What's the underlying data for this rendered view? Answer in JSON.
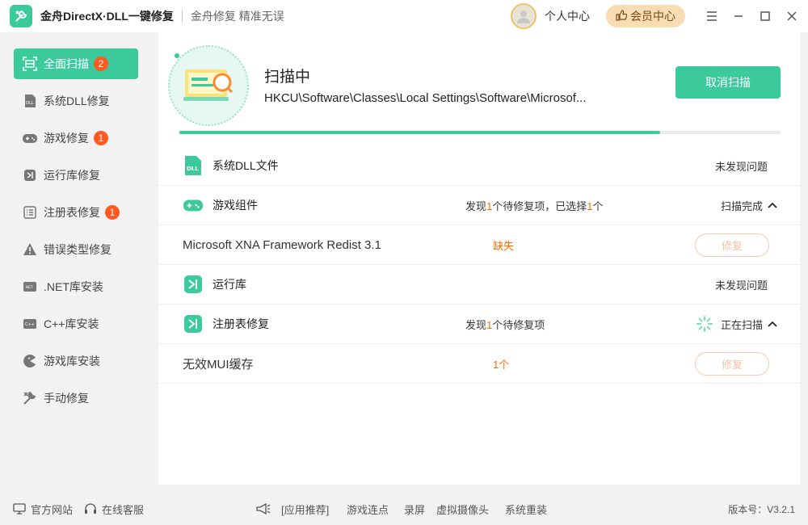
{
  "app": {
    "title": "金舟DirectX·DLL一键修复",
    "slogan": "金舟修复 精准无误",
    "profile_label": "个人中心",
    "vip_label": "会员中心"
  },
  "sidebar": {
    "items": [
      {
        "label": "全面扫描",
        "badge": "2"
      },
      {
        "label": "系统DLL修复",
        "badge": ""
      },
      {
        "label": "游戏修复",
        "badge": "1"
      },
      {
        "label": "运行库修复",
        "badge": ""
      },
      {
        "label": "注册表修复",
        "badge": "1"
      },
      {
        "label": "错误类型修复",
        "badge": ""
      },
      {
        "label": ".NET库安装",
        "badge": ""
      },
      {
        "label": "C++库安装",
        "badge": ""
      },
      {
        "label": "游戏库安装",
        "badge": ""
      },
      {
        "label": "手动修复",
        "badge": ""
      }
    ]
  },
  "scan": {
    "status": "扫描中",
    "path": "HKCU\\Software\\Classes\\Local Settings\\Software\\Microsof...",
    "cancel_label": "取消扫描",
    "progress": 0.8
  },
  "results": {
    "dll": {
      "title": "系统DLL文件",
      "status": "未发现问题"
    },
    "game": {
      "title": "游戏组件",
      "summary_pre": "发现",
      "summary_count": "1",
      "summary_mid": "个待修复项，已选择",
      "summary_sel": "1",
      "summary_post": "个",
      "status": "扫描完成"
    },
    "game_item": {
      "name": "Microsoft XNA Framework Redist 3.1",
      "state": "缺失",
      "repair_label": "修复"
    },
    "runtime": {
      "title": "运行库",
      "status": "未发现问题"
    },
    "registry": {
      "title": "注册表修复",
      "summary_pre": "发现",
      "summary_count": "1",
      "summary_post": "个待修复项",
      "status": "正在扫描"
    },
    "registry_item": {
      "name": "无效MUI缓存",
      "count": "1个",
      "repair_label": "修复"
    }
  },
  "footer": {
    "website": "官方网站",
    "support": "在线客服",
    "recommend": "[应用推荐]",
    "links": [
      "游戏连点",
      "录屏",
      "虚拟摄像头",
      "系统重装"
    ],
    "version": "版本号：V3.2.1"
  },
  "colors": {
    "accent": "#3cc99b",
    "warning": "#ff6a00",
    "badge": "#ff5a1f"
  }
}
